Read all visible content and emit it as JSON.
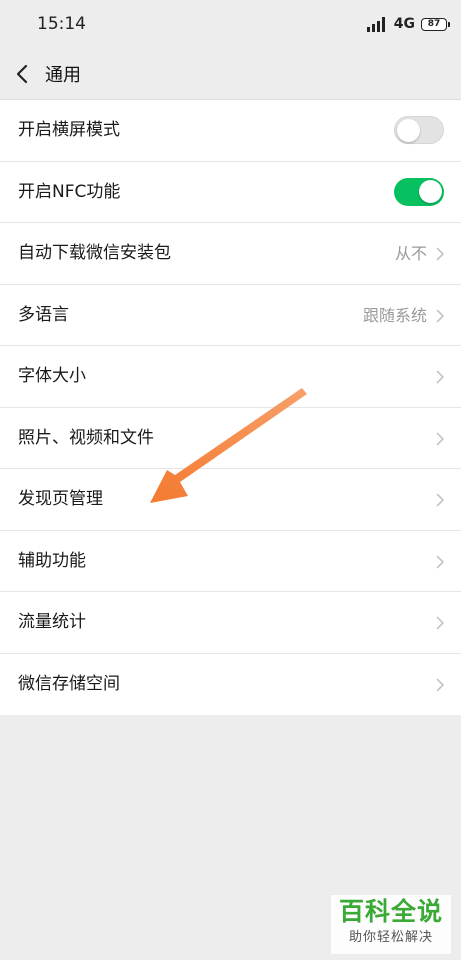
{
  "status_bar": {
    "time": "15:14",
    "network": "4G",
    "battery": "87"
  },
  "nav": {
    "title": "通用",
    "back_icon": "chevron-left-icon"
  },
  "settings": [
    {
      "label": "开启横屏模式",
      "control": "toggle",
      "on": false
    },
    {
      "label": "开启NFC功能",
      "control": "toggle",
      "on": true
    },
    {
      "label": "自动下载微信安装包",
      "value": "从不",
      "control": "chevron"
    },
    {
      "label": "多语言",
      "value": "跟随系统",
      "control": "chevron"
    },
    {
      "label": "字体大小",
      "value": "",
      "control": "chevron"
    },
    {
      "label": "照片、视频和文件",
      "value": "",
      "control": "chevron"
    },
    {
      "label": "发现页管理",
      "value": "",
      "control": "chevron"
    },
    {
      "label": "辅助功能",
      "value": "",
      "control": "chevron"
    },
    {
      "label": "流量统计",
      "value": "",
      "control": "chevron"
    },
    {
      "label": "微信存储空间",
      "value": "",
      "control": "chevron"
    }
  ],
  "annotation": {
    "color": "#f47a30",
    "points_to": "发现页管理"
  },
  "watermark": {
    "title": "百科全说",
    "subtitle": "助你轻松解决"
  },
  "colors": {
    "background": "#ededed",
    "toggle_on": "#07c160",
    "secondary_text": "#9a9a9a"
  }
}
